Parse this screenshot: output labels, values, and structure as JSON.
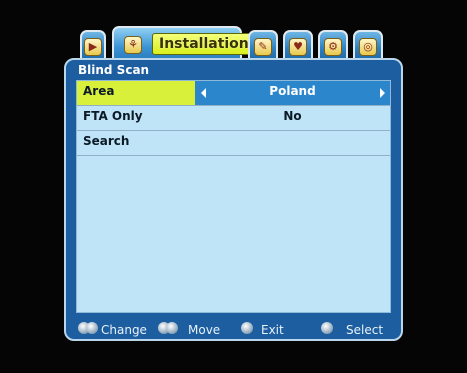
{
  "tabs": [
    {
      "name": "tab-media",
      "icon": "media-icon",
      "glyph": "▶"
    },
    {
      "name": "tab-installation",
      "icon": "satellite-dish-icon",
      "label": "Installation",
      "glyph": "⚘"
    },
    {
      "name": "tab-tools",
      "icon": "tools-icon",
      "glyph": "✎"
    },
    {
      "name": "tab-favorites",
      "icon": "heart-icon",
      "glyph": "♥"
    },
    {
      "name": "tab-settings",
      "icon": "gear-icon",
      "glyph": "⚙"
    },
    {
      "name": "tab-system",
      "icon": "globe-icon",
      "glyph": "◎"
    }
  ],
  "screen_title": "Blind Scan",
  "rows": [
    {
      "label": "Area",
      "value": "Poland"
    },
    {
      "label": "FTA Only",
      "value": "No"
    },
    {
      "label": "Search",
      "value": ""
    }
  ],
  "footer": {
    "change": "Change",
    "move": "Move",
    "exit": "Exit",
    "select": "Select"
  },
  "colors": {
    "panel": "#1c5ea0",
    "content": "#bfe4f7",
    "highlight": "#d9f03a",
    "value_bar": "#2c86cb"
  }
}
